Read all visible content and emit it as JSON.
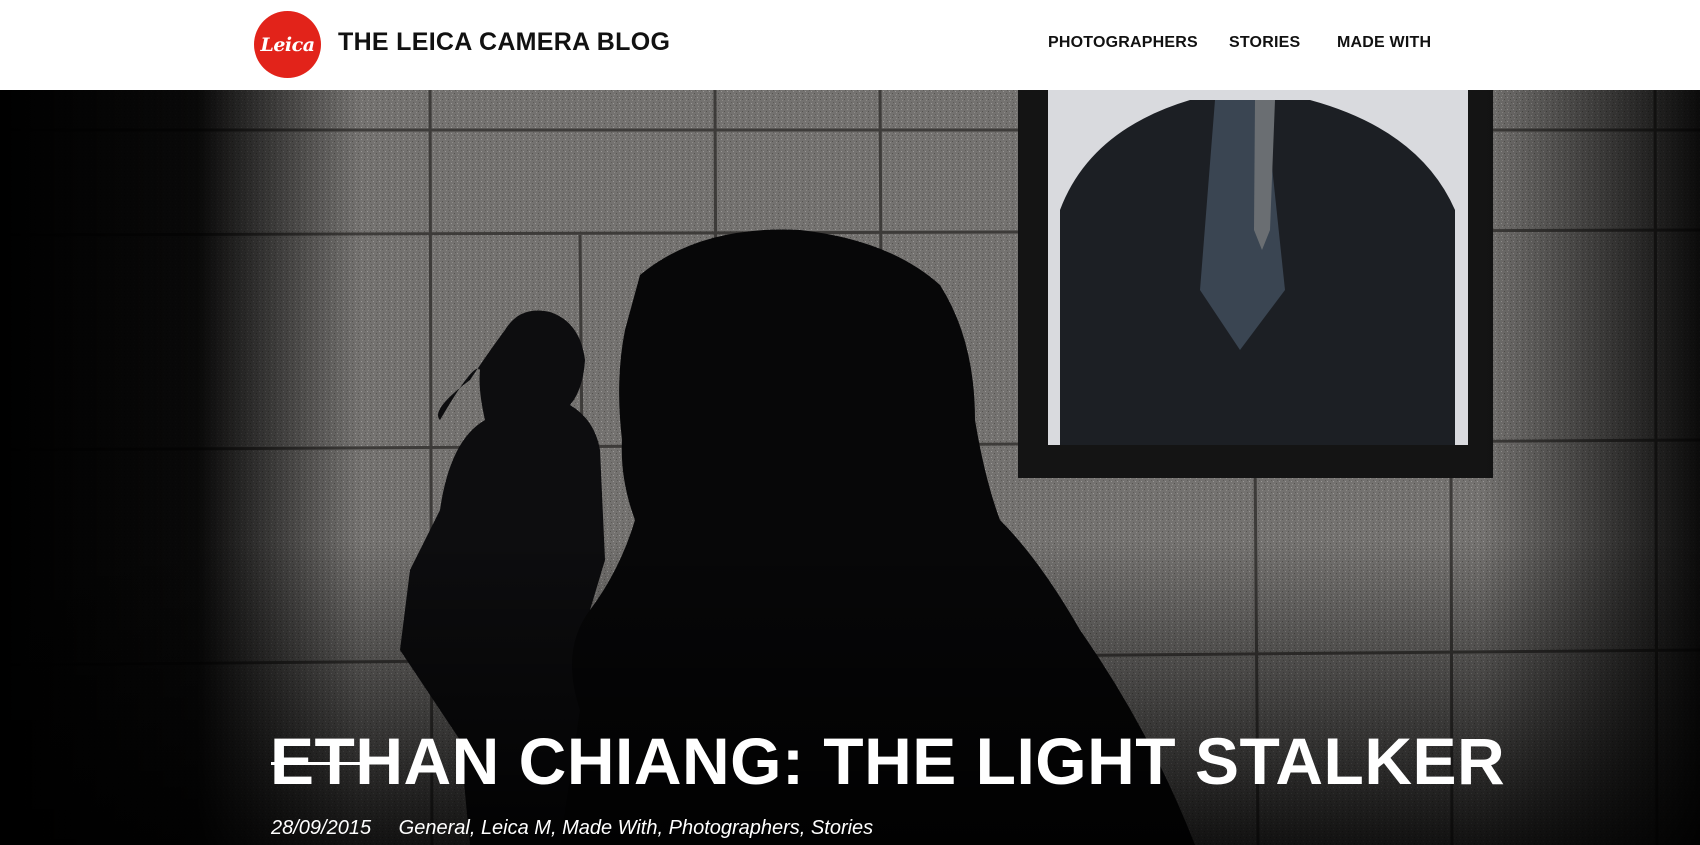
{
  "header": {
    "logo_text": "Leica",
    "site_title": "THE LEICA CAMERA BLOG",
    "nav": [
      {
        "label": "PHOTOGRAPHERS"
      },
      {
        "label": "STORIES"
      },
      {
        "label": "MADE WITH"
      }
    ]
  },
  "hero": {
    "title": "ETHAN CHIANG: THE LIGHT STALKER",
    "date": "28/09/2015",
    "categories": "General, Leica M, Made With, Photographers, Stories"
  },
  "colors": {
    "brand_red": "#e2231a",
    "header_bg": "#ffffff",
    "hero_text": "#ffffff"
  }
}
